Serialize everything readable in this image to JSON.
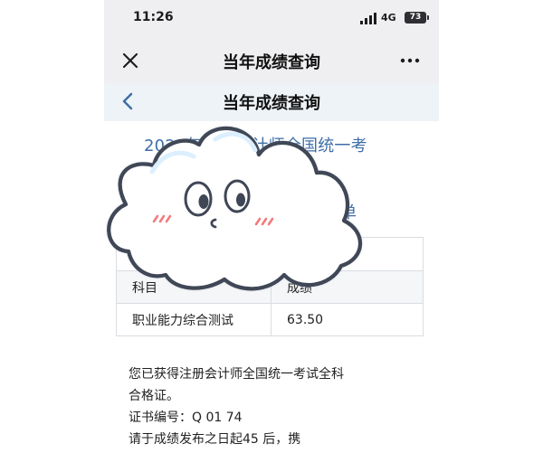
{
  "status_bar": {
    "time": "11:26",
    "network": "4G",
    "battery": "73"
  },
  "wechat_header": {
    "title": "当年成绩查询",
    "close_icon": "close-icon",
    "more_icon": "more-icon"
  },
  "page_header": {
    "title": "当年成绩查询",
    "back_icon": "chevron-left-icon"
  },
  "content": {
    "exam_title": "2022年注册会计师全国统一考",
    "fragment_1": "",
    "fragment_2": "绩单",
    "table": {
      "top_row": {
        "label": "",
        "value": ""
      },
      "header": {
        "subject": "科目",
        "score": "成绩"
      },
      "rows": [
        {
          "subject": "职业能力综合测试",
          "score": "63.50"
        }
      ]
    },
    "result_lines": [
      "您已获得注册会计师全国统一考试全科",
      "合格证。",
      "证书编号：Q    01  74",
      "请于成绩发布之日起45       后，携"
    ]
  },
  "sticker": {
    "type": "cloud-face",
    "colors": {
      "outline": "#3f4656",
      "fill": "#ffffff",
      "shadow": "#e9f4ff",
      "blush": "#f3797c"
    }
  }
}
